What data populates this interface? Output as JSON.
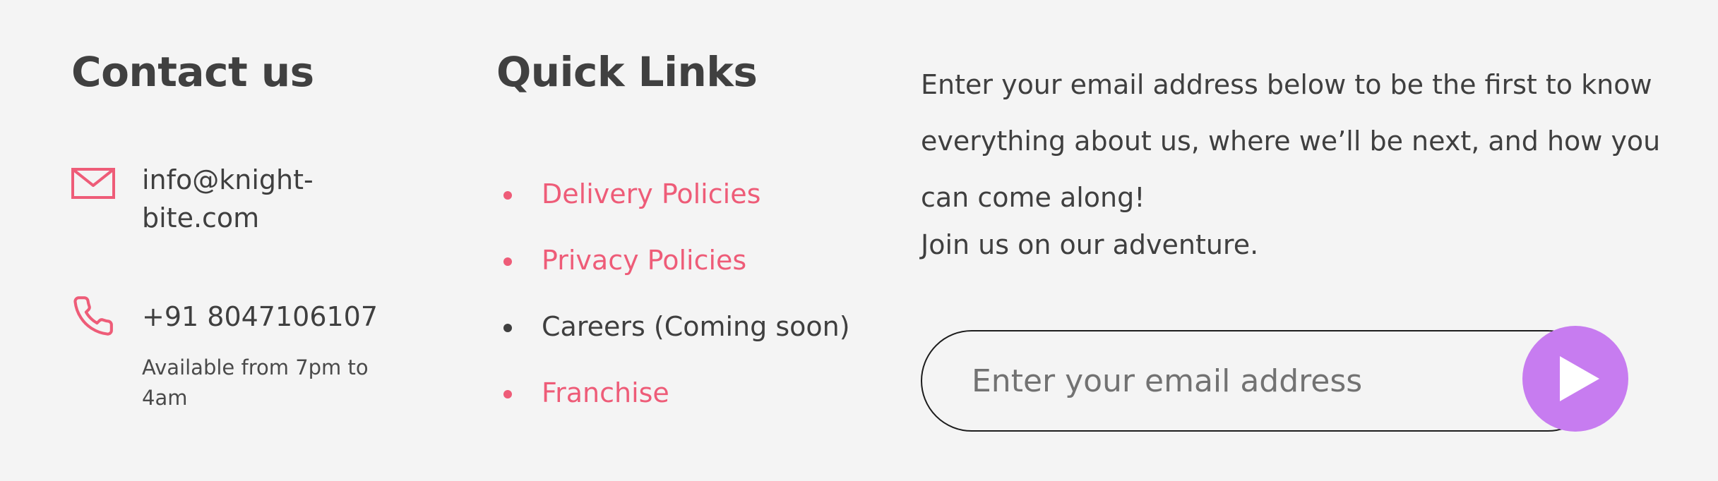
{
  "contact": {
    "heading": "Contact us",
    "email_icon": "mail-icon",
    "email": "info@knight-bite.com",
    "phone_icon": "phone-icon",
    "phone": "+91 8047106107",
    "hours": "Available from 7pm to 4am"
  },
  "quick_links": {
    "heading": "Quick Links",
    "items": [
      {
        "label": "Delivery Policies"
      },
      {
        "label": "Privacy Policies"
      },
      {
        "label": "Careers (Coming soon)"
      },
      {
        "label": "Franchise"
      }
    ]
  },
  "newsletter": {
    "description": "Enter your email address below to be the first to know everything about us, where we’ll be next, and how you can come along!",
    "join": "Join us on our adventure.",
    "input_placeholder": "Enter your email address",
    "submit_icon": "play-arrow-icon"
  },
  "colors": {
    "accent": "#ee5c78",
    "submit": "#c77cf0",
    "background": "#f4f4f4",
    "text": "#3f3f3f"
  }
}
